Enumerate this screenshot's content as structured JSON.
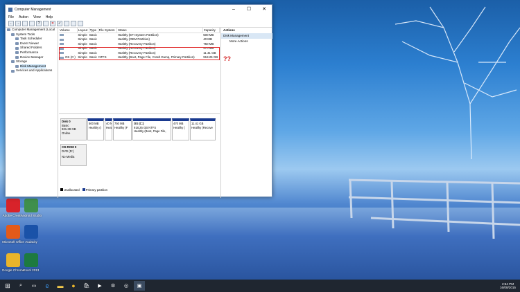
{
  "window": {
    "title": "Computer Management",
    "controls": [
      "–",
      "☐",
      "✕"
    ]
  },
  "menu": [
    "File",
    "Action",
    "View",
    "Help"
  ],
  "tree": [
    {
      "label": "Computer Management (Local",
      "indent": 0,
      "sel": false
    },
    {
      "label": "System Tools",
      "indent": 1,
      "sel": false
    },
    {
      "label": "Task Scheduler",
      "indent": 2,
      "sel": false
    },
    {
      "label": "Event Viewer",
      "indent": 2,
      "sel": false
    },
    {
      "label": "Shared Folders",
      "indent": 2,
      "sel": false
    },
    {
      "label": "Performance",
      "indent": 2,
      "sel": false
    },
    {
      "label": "Device Manager",
      "indent": 2,
      "sel": false
    },
    {
      "label": "Storage",
      "indent": 1,
      "sel": false
    },
    {
      "label": "Disk Management",
      "indent": 2,
      "sel": true
    },
    {
      "label": "Services and Applications",
      "indent": 1,
      "sel": false
    }
  ],
  "volume_table": {
    "headers": [
      "Volume",
      "Layout",
      "Type",
      "File System",
      "Status",
      "Capacity"
    ],
    "rows": [
      [
        "",
        "Simple",
        "Basic",
        "",
        "Healthy (EFI System Partition)",
        "500 MB"
      ],
      [
        "",
        "Simple",
        "Basic",
        "",
        "Healthy (OEM Partition)",
        "40 MB"
      ],
      [
        "",
        "Simple",
        "Basic",
        "",
        "Healthy (Recovery Partition)",
        "750 MB"
      ],
      [
        "",
        "Simple",
        "Basic",
        "",
        "Healthy (Recovery Partition)",
        "470 MB"
      ],
      [
        "",
        "Simple",
        "Basic",
        "",
        "Healthy (Recovery Partition)",
        "11.41 GB"
      ],
      [
        "OS (C:)",
        "Simple",
        "Basic",
        "NTFS",
        "Healthy (Boot, Page File, Crash Dump, Primary Partition)",
        "918.25 GB"
      ]
    ]
  },
  "disk0": {
    "name": "Disk 0",
    "type": "Basic",
    "size": "931.39 GB",
    "state": "Online",
    "parts": [
      {
        "l1": "",
        "l2": "500 MB",
        "l3": "Healthy (I"
      },
      {
        "l1": "",
        "l2": "40 N",
        "l3": "Heal"
      },
      {
        "l1": "",
        "l2": "750 MB",
        "l3": "Healthy (F"
      },
      {
        "l1": "OS (C:)",
        "l2": "918.25 GB NTFS",
        "l3": "Healthy (Boot, Page File,"
      },
      {
        "l1": "",
        "l2": "470 MB",
        "l3": "Healthy ("
      },
      {
        "l1": "",
        "l2": "11.41 GB",
        "l3": "Healthy (Recove"
      }
    ]
  },
  "cdrom": {
    "name": "CD-ROM 0",
    "type": "DVD (D:)",
    "media": "No Media"
  },
  "legend": {
    "unallocated": "Unallocated",
    "primary": "Primary partition"
  },
  "actions": {
    "header": "Actions",
    "section": "Disk Management",
    "more": "More Actions"
  },
  "annotation": "??",
  "desktop_icons": [
    {
      "label": "Adobe Creati...",
      "color": "#d8232a"
    },
    {
      "label": "Android Studio",
      "color": "#3f8f4c"
    },
    {
      "label": "Microsoft Office",
      "color": "#e35a1a"
    },
    {
      "label": "Audacity",
      "color": "#1a52a8"
    },
    {
      "label": "Google Chrome",
      "color": "#e9b42b"
    },
    {
      "label": "Excel 2013",
      "color": "#1d7a3f"
    }
  ],
  "clock": {
    "time": "2:54 PM",
    "date": "16/08/2015"
  },
  "colors": {
    "primary_partition": "#1a3a8f",
    "unallocated": "#000000",
    "highlight": "#e12828"
  }
}
